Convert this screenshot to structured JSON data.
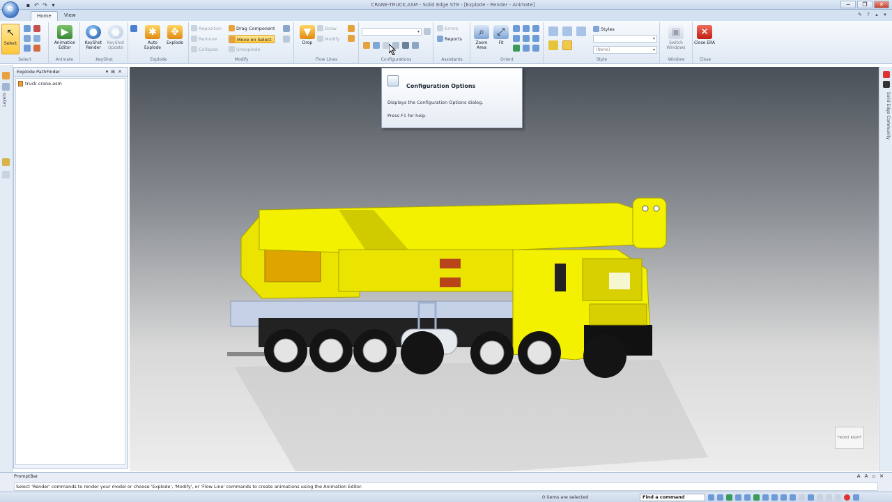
{
  "titlebar": {
    "title": "CRANE-TRUCK.ASM - Solid Edge ST8 - [Explode - Render - Animate]",
    "qat_icons": [
      "save-icon",
      "undo-icon",
      "redo-icon",
      "print-icon"
    ],
    "window_controls": [
      "─",
      "❐",
      "✕"
    ]
  },
  "tabs": [
    "Home",
    "View"
  ],
  "ribbon": {
    "select": {
      "label": "Select",
      "group": "Select"
    },
    "animate": {
      "animation_editor": "Animation Editor",
      "group": "Animate"
    },
    "keyshot": {
      "render": "KeyShot Render",
      "update": "KeyShot Update",
      "group": "KeyShot"
    },
    "explode": {
      "auto_explode": "Auto Explode",
      "explode": "Explode",
      "group": "Explode"
    },
    "modify": {
      "reposition": "Reposition",
      "remove": "Remove",
      "collapse": "Collapse",
      "drag_component": "Drag Component",
      "move_on_select": "Move on Select",
      "unexplode": "Unexplode",
      "group": "Modify"
    },
    "flow_lines": {
      "drop": "Drop",
      "draw": "Draw",
      "modify": "Modify",
      "group": "Flow Lines"
    },
    "configurations": {
      "group": "Configurations"
    },
    "assistants": {
      "errors": "Errors",
      "reports": "Reports",
      "group": "Assistants"
    },
    "orient": {
      "zoom_area": "Zoom Area",
      "fit": "Fit",
      "group": "Orient"
    },
    "style": {
      "styles": "Styles",
      "style_value": "(None)",
      "group": "Style"
    },
    "window": {
      "switch_windows": "Switch Windows",
      "group": "Window"
    },
    "close": {
      "close_era": "Close ERA",
      "group": "Close"
    }
  },
  "left_strip": {
    "tab_label": "Layers"
  },
  "pathfinder": {
    "title": "Explode PathFinder",
    "item": "truck crane.asm"
  },
  "tooltip": {
    "title": "Configuration Options",
    "description": "Displays the Configuration Options dialog.",
    "help": "Press F1 for help."
  },
  "right_strip": {
    "tab_label": "Solid Edge Community"
  },
  "viewcube": {
    "label": "FRONT  RIGHT"
  },
  "promptbar": {
    "title": "PromptBar",
    "message": "Select 'Render' commands to render your model or choose 'Explode', 'Modify', or 'Flow Line' commands to create animations using the Animation Editor."
  },
  "statusbar": {
    "selection": "0 items are selected",
    "find_placeholder": "Find a command"
  },
  "colors": {
    "crane_yellow": "#f3f000",
    "ribbon_blue": "#dfe8f4",
    "close_red": "#c6422c"
  }
}
